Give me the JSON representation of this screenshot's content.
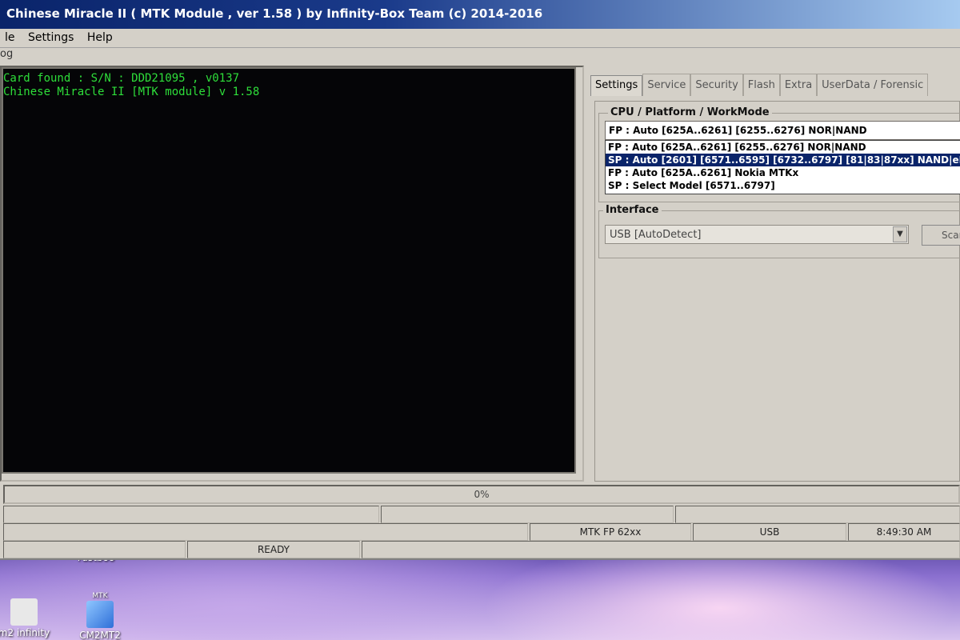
{
  "window": {
    "title": "Chinese Miracle II ( MTK Module , ver 1.58 ) by Infinity-Box Team (c) 2014-2016"
  },
  "menu": {
    "items": [
      "le",
      "Settings",
      "Help"
    ]
  },
  "log": {
    "caption": "og",
    "lines": [
      "Card found : S/N : DDD21095 , v0137",
      "Chinese Miracle II  [MTK module] v 1.58"
    ]
  },
  "tabs": [
    "Settings",
    "Service",
    "Security",
    "Flash",
    "Extra",
    "UserData / Forensic"
  ],
  "cpu_group": {
    "title": "CPU / Platform / WorkMode",
    "selected": "FP : Auto [625A..6261] [6255..6276] NOR|NAND",
    "options": [
      "FP : Auto [625A..6261] [6255..6276] NOR|NAND",
      "SP : Auto [2601] [6571..6595] [6732..6797] [81|83|87xx] NAND|eMMC",
      "FP : Auto [625A..6261] Nokia MTKx",
      "SP : Select Model [6571..6797]"
    ],
    "highlighted_index": 1
  },
  "interface_group": {
    "title": "Interface",
    "value": "USB [AutoDetect]",
    "scan_label": "Scan"
  },
  "progress": {
    "text": "0%",
    "value": 0
  },
  "status": {
    "ready": "READY",
    "mode": "MTK FP 62xx",
    "port": "USB",
    "time": "8:49:30 AM"
  },
  "desktop": {
    "icons": [
      {
        "label": "m2 infinity"
      },
      {
        "label": "CM2MT2",
        "badge": "MTK"
      },
      {
        "label": "Fastboo"
      }
    ]
  },
  "colors": {
    "log_text": "#2ede3a",
    "log_bg": "#050507",
    "selection": "#0a246a",
    "titlebar": "#0a246a"
  }
}
